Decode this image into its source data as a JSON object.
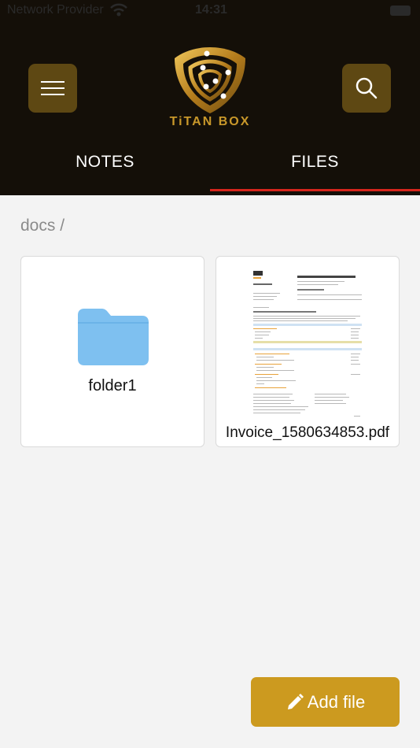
{
  "status_bar": {
    "carrier": "Network Provider",
    "time": "14:31"
  },
  "app": {
    "logo_text": "TiTAN BOX"
  },
  "tabs": [
    {
      "label": "NOTES",
      "active": false
    },
    {
      "label": "FILES",
      "active": true
    }
  ],
  "breadcrumb": "docs /",
  "items": [
    {
      "type": "folder",
      "name": "folder1"
    },
    {
      "type": "file",
      "name": "Invoice_1580634853.pdf"
    }
  ],
  "fab": {
    "label": "Add file"
  },
  "colors": {
    "header_bg": "#140f08",
    "accent_gold": "#cc9a1f",
    "tab_indicator": "#d6251c",
    "folder": "#7ec0f0"
  },
  "icons": [
    "wifi-icon",
    "battery-icon",
    "hamburger-menu-icon",
    "search-icon",
    "titan-box-logo",
    "folder-icon",
    "pdf-thumbnail",
    "pencil-icon"
  ]
}
